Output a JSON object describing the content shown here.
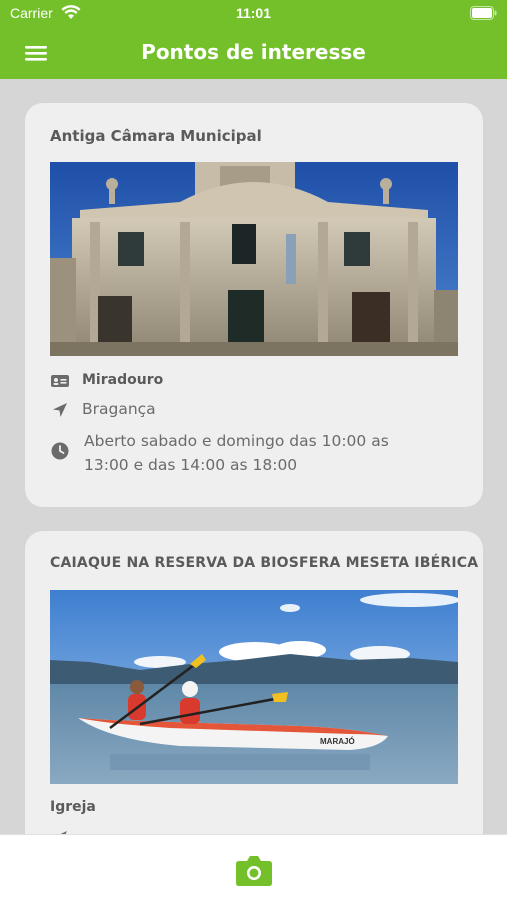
{
  "status_bar": {
    "carrier": "Carrier",
    "time": "11:01"
  },
  "nav": {
    "title": "Pontos de interesse"
  },
  "cards": [
    {
      "title": "Antiga Câmara Municipal",
      "category": "Miradouro",
      "location": "Bragança",
      "hours": "Aberto sabado e domingo das 10:00 as 13:00 e das 14:00 as 18:00"
    },
    {
      "title": "CAIAQUE NA RESERVA DA BIOSFERA MESETA IBÉRICA",
      "category": "Igreja",
      "kayak_text": "MARAJÓ"
    }
  ],
  "colors": {
    "brand_green": "#74c02a",
    "card_bg": "#efefef",
    "page_bg": "#d6d6d6"
  }
}
